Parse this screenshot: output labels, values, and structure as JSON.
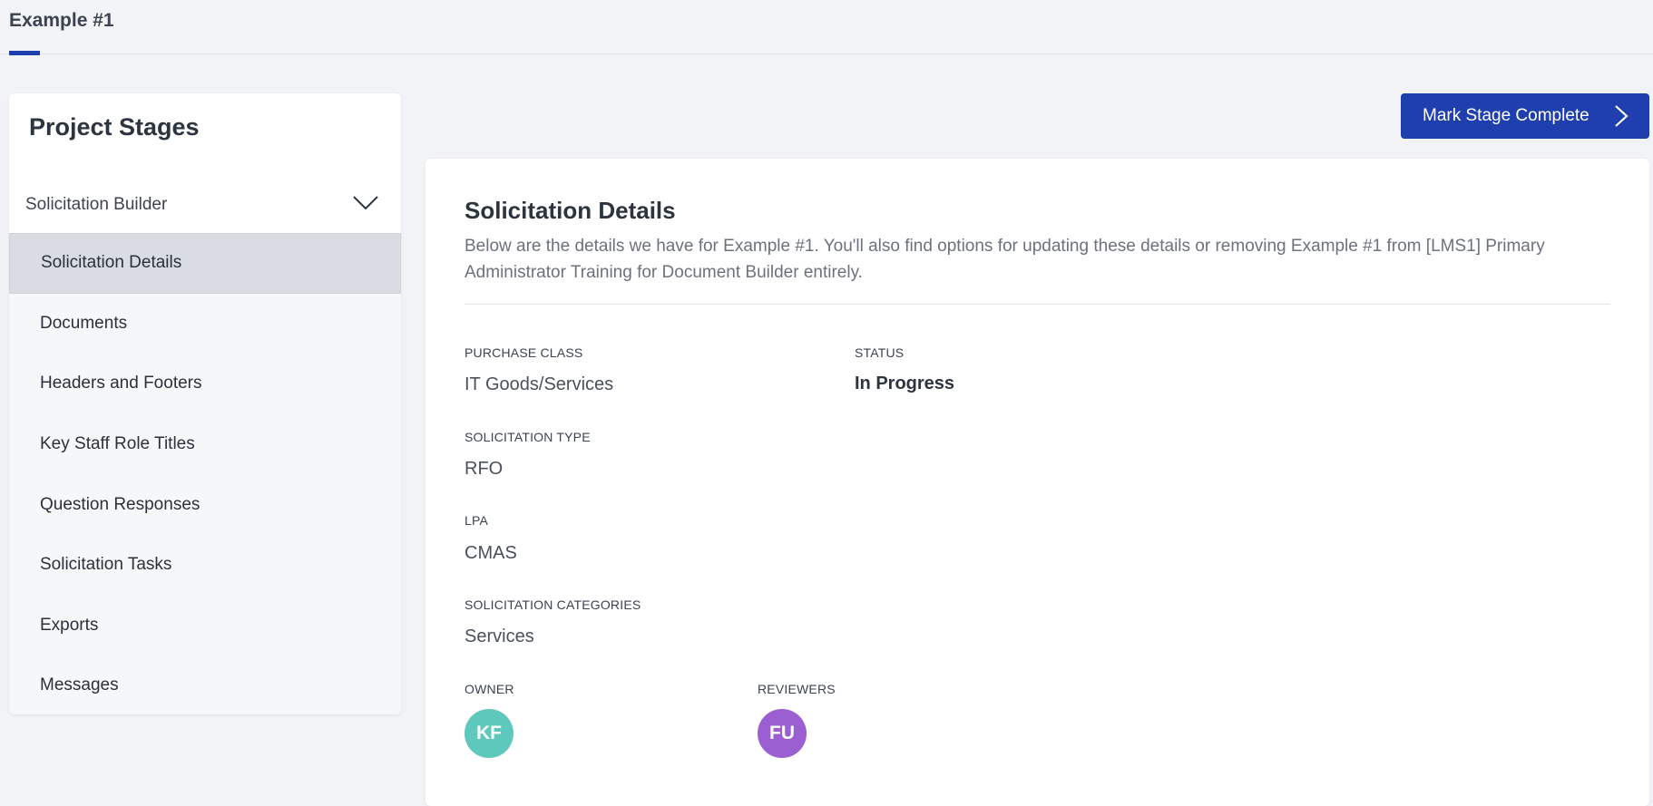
{
  "tab": {
    "label": "Example #1"
  },
  "sidebar": {
    "title": "Project Stages",
    "group_label": "Solicitation Builder",
    "items": [
      {
        "label": "Solicitation Details",
        "active": true
      },
      {
        "label": "Documents"
      },
      {
        "label": "Headers and Footers"
      },
      {
        "label": "Key Staff Role Titles"
      },
      {
        "label": "Question Responses"
      },
      {
        "label": "Solicitation Tasks"
      },
      {
        "label": "Exports"
      },
      {
        "label": "Messages"
      }
    ]
  },
  "action": {
    "mark_complete_label": "Mark Stage Complete"
  },
  "details": {
    "title": "Solicitation Details",
    "description": "Below are the details we have for Example #1. You'll also find options for updating these details or removing Example #1 from [LMS1] Primary Administrator Training for Document Builder entirely.",
    "purchase_class": {
      "label": "PURCHASE CLASS",
      "value": "IT Goods/Services"
    },
    "status": {
      "label": "STATUS",
      "value": "In Progress"
    },
    "solicitation_type": {
      "label": "SOLICITATION TYPE",
      "value": "RFO"
    },
    "lpa": {
      "label": "LPA",
      "value": "CMAS"
    },
    "categories": {
      "label": "SOLICITATION CATEGORIES",
      "value": "Services"
    },
    "owner": {
      "label": "OWNER",
      "initials": "KF",
      "color": "#5ec8bd"
    },
    "reviewers": {
      "label": "REVIEWERS",
      "initials": "FU",
      "color": "#9b5fd1"
    }
  },
  "colors": {
    "primary": "#1f3fae",
    "background": "#f2f3f7",
    "active_item": "#d9dde3"
  }
}
